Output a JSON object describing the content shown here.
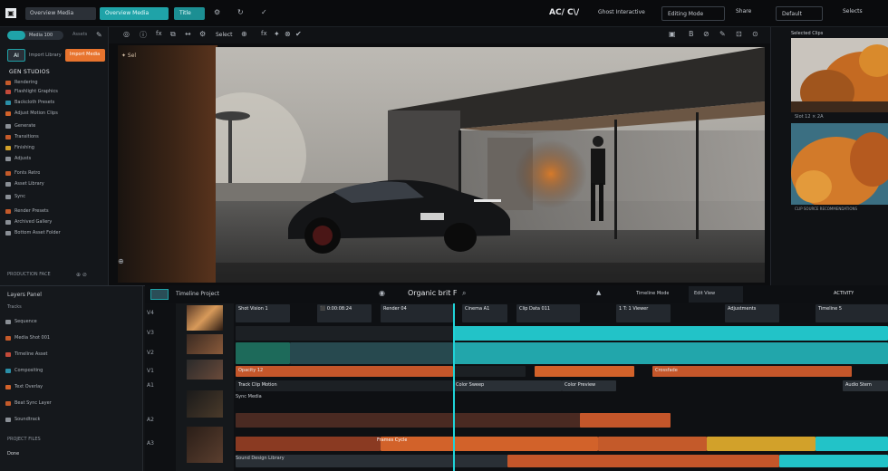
{
  "app": {
    "brand_glyph": "▣",
    "top_tab_active": "Overview Media",
    "top_tab_2": "Title",
    "top_icons": [
      "⚙",
      "↻",
      "✓"
    ],
    "center_title": "AC/ C\\/",
    "project_label": "Ghost Interactive",
    "right_tab": "Editing Mode",
    "right_tab_2": "Share",
    "export_label": "Default",
    "far_right": "Selects"
  },
  "left_panel": {
    "toggle_label": "Media 100",
    "search_hint": "Assets",
    "ai_button": "AI",
    "ai_subtitle": "Import Library",
    "orange_button": "Import Media",
    "section_title": "GEN STUDIOS",
    "items": [
      {
        "label": "Rendering",
        "color": "#c45a2a"
      },
      {
        "label": "Flashlight Graphics",
        "color": "#c44a3a"
      },
      {
        "label": "Backcloth Presets",
        "color": "#2a8fa8"
      },
      {
        "label": "Adjust Motion Clips",
        "color": "#d2622a"
      },
      {
        "label": "Generate",
        "color": "#8a8f96"
      },
      {
        "label": "Transitions",
        "color": "#c45a2a"
      },
      {
        "label": "Finishing",
        "color": "#d2a12a"
      },
      {
        "label": "Adjusts",
        "color": "#8a8f96"
      },
      {
        "label": "Fonts Retro",
        "color": "#c45a2a"
      },
      {
        "label": "Asset Library",
        "color": "#8a8f96"
      },
      {
        "label": "Sync",
        "color": "#8a8f96"
      },
      {
        "label": "Render Presets",
        "color": "#c45a2a"
      },
      {
        "label": "Archived Gallery",
        "color": "#8a8f96"
      },
      {
        "label": "Bottom Asset Folder",
        "color": "#8a8f96"
      }
    ],
    "footer_left": "PRODUCTION FACE",
    "footer_right": "⊕ ⊘"
  },
  "viewer": {
    "toolbar_left": [
      "◎",
      "ⓘ",
      "fx",
      "⧉",
      "↔",
      "⚙",
      "⊞"
    ],
    "toolbar_label": "Select",
    "toolbar_mid": [
      "⊕",
      "fx",
      "✦",
      "⊗",
      "✔"
    ],
    "toolbar_right": [
      "▣",
      "B",
      "⊘",
      "✎",
      "⊡",
      "⊙"
    ],
    "overlay_tl": "✦ Sel",
    "overlay_bl": "⊕"
  },
  "right_panel": {
    "header": "Selected Clips",
    "thumb1_caption": "Slot 12 × 2A",
    "thumb2_caption": "CLIP SOURCE RECOMMENDATIONS"
  },
  "timeline": {
    "header_label": "Timeline Project",
    "center_title": "Organic brit F",
    "right_label": "Timeline Mode",
    "right_2": "Edit View",
    "right_3": "ACTIVITY",
    "left_tracks_title": "Layers Panel",
    "left_sub": "Tracks",
    "left_items": [
      "Sequence",
      "Media Shot 001",
      "Timeline Asset",
      "Compositing",
      "Text Overlay",
      "Beat Sync Layer",
      "Soundtrack"
    ],
    "left_footer": "PROJECT FILES",
    "left_footer_2": "Done",
    "track_labels": [
      "V4",
      "V3",
      "V2",
      "V1",
      "A1",
      "A2",
      "A3"
    ],
    "clip_labels": [
      "Shot Vision 1",
      "⬛ 0:00:08:24",
      "Render 04",
      "Cinema A1",
      "Clip Data 011",
      "1 T: 1 Viewer",
      "Adjustments",
      "Timeline 5",
      "Opacity 12",
      "Crossfade",
      "Track Clip Motion",
      "Color Sweep",
      "Color Preview",
      "Audio Stem"
    ],
    "track_note": "Sync Media",
    "track_note_2": "Frames Cycle",
    "track_note_3": "Sound Design Library"
  }
}
